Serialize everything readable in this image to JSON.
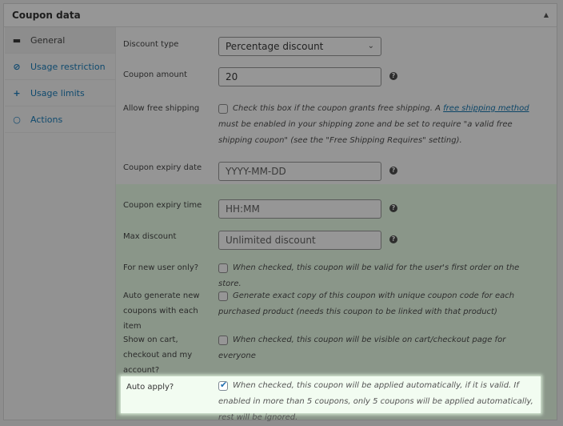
{
  "panel": {
    "title": "Coupon data",
    "toggle_icon": "triangle-up-icon"
  },
  "sidebar": {
    "tabs": [
      {
        "label": "General",
        "icon": "ticket-icon",
        "glyph": "▬",
        "active": true
      },
      {
        "label": "Usage restriction",
        "icon": "ban-icon",
        "glyph": "⊘",
        "active": false
      },
      {
        "label": "Usage limits",
        "icon": "limits-icon",
        "glyph": "+",
        "active": false
      },
      {
        "label": "Actions",
        "icon": "gear-icon",
        "glyph": "○",
        "active": false
      }
    ]
  },
  "fields": {
    "discount_type": {
      "label": "Discount type",
      "value": "Percentage discount"
    },
    "coupon_amount": {
      "label": "Coupon amount",
      "value": "20"
    },
    "free_shipping": {
      "label": "Allow free shipping",
      "desc_before": "Check this box if the coupon grants free shipping. A ",
      "link": "free shipping method",
      "desc_after": " must be enabled in your shipping zone and be set to require \"a valid free shipping coupon\" (see the \"Free Shipping Requires\" setting).",
      "checked": false
    },
    "expiry_date": {
      "label": "Coupon expiry date",
      "placeholder": "YYYY-MM-DD"
    },
    "expiry_time": {
      "label": "Coupon expiry time",
      "placeholder": "HH:MM"
    },
    "max_discount": {
      "label": "Max discount",
      "placeholder": "Unlimited discount"
    },
    "new_user": {
      "label": "For new user only?",
      "desc": "When checked, this coupon will be valid for the user's first order on the store.",
      "checked": false
    },
    "auto_generate": {
      "label": "Auto generate new coupons with each item",
      "desc": "Generate exact copy of this coupon with unique coupon code for each purchased product (needs this coupon to be linked with that product)",
      "checked": false
    },
    "show_on_cart": {
      "label": "Show on cart, checkout and my account?",
      "desc": "When checked, this coupon will be visible on cart/checkout page for everyone",
      "checked": false
    },
    "auto_apply": {
      "label": "Auto apply?",
      "desc": "When checked, this coupon will be applied automatically, if it is valid. If enabled in more than 5 coupons, only 5 coupons will be applied automatically, rest will be ignored.",
      "checked": true
    }
  },
  "help_glyph": "?",
  "chevron_glyph": "⌄",
  "check_glyph": "✔",
  "triangle_glyph": "▲"
}
